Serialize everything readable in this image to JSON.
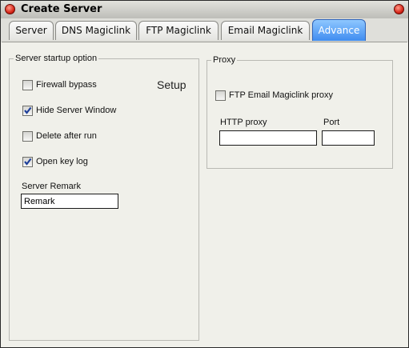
{
  "window": {
    "title": "Create Server"
  },
  "tabs": [
    "Server",
    "DNS Magiclink",
    "FTP Magiclink",
    "Email Magiclink",
    "Advance"
  ],
  "startup": {
    "legend": "Server startup option",
    "firewall_label": "Firewall bypass",
    "firewall_checked": false,
    "setup_label": "Setup",
    "hide_window_label": "Hide Server Window",
    "hide_window_checked": true,
    "delete_label": "Delete after run",
    "delete_checked": false,
    "keylog_label": "Open key log",
    "keylog_checked": true,
    "remark_label": "Server Remark",
    "remark_value": "Remark"
  },
  "proxy": {
    "legend": "Proxy",
    "ftp_email_label": "FTP Email Magiclink proxy",
    "ftp_email_checked": false,
    "http_label": "HTTP proxy",
    "http_value": "",
    "port_label": "Port",
    "port_value": ""
  },
  "colors": {
    "active_tab": "#3f8cf0",
    "check_mark": "#1e3f9a"
  }
}
